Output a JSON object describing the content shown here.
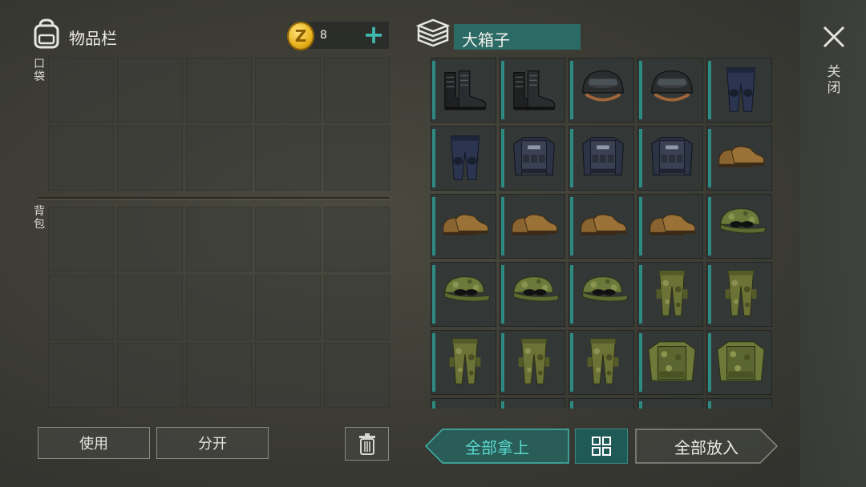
{
  "inventory": {
    "title": "物品栏",
    "coins": "8",
    "coin_symbol": "Z",
    "pocket_label": "口袋",
    "backpack_label": "背包",
    "pocket_slots": 10,
    "backpack_slots": 15
  },
  "container": {
    "title": "大箱子",
    "items": [
      "black-boots",
      "black-boots",
      "black-helmet",
      "black-helmet",
      "navy-pants",
      "navy-pants",
      "police-vest",
      "police-vest",
      "police-vest",
      "brown-shoes",
      "brown-shoes",
      "brown-shoes",
      "brown-shoes",
      "brown-shoes",
      "camo-cap",
      "camo-cap",
      "camo-cap",
      "camo-cap",
      "camo-pants",
      "camo-pants",
      "camo-pants",
      "camo-pants",
      "camo-pants",
      "camo-vest",
      "camo-vest"
    ]
  },
  "close": {
    "label": "关闭"
  },
  "buttons": {
    "use": "使用",
    "split": "分开",
    "take_all": "全部拿上",
    "store_all": "全部放入"
  },
  "colors": {
    "accent_teal": "#3fb8ad",
    "title_bg": "#2c6a66",
    "coin_gold": "#e8b21d"
  }
}
